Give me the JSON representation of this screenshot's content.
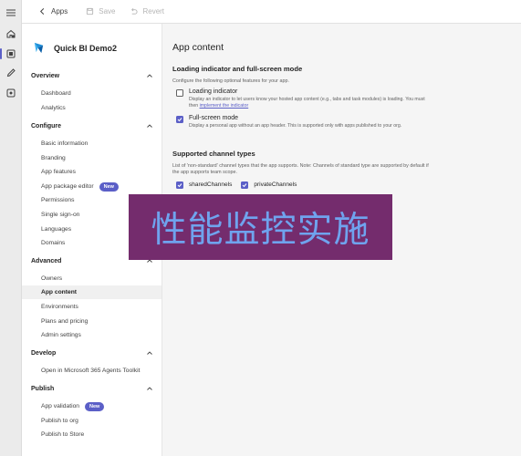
{
  "rail": {
    "icons": [
      "home-icon",
      "apps-icon",
      "edit-icon",
      "bot-icon"
    ]
  },
  "topbar": {
    "back_label": "Apps",
    "save_label": "Save",
    "revert_label": "Revert"
  },
  "sidebar": {
    "app_name": "Quick BI Demo2",
    "sections": [
      {
        "title": "Overview",
        "items": [
          "Dashboard",
          "Analytics"
        ]
      },
      {
        "title": "Configure",
        "items": [
          "Basic information",
          "Branding",
          "App features",
          "App package editor",
          "Permissions",
          "Single sign-on",
          "Languages",
          "Domains"
        ]
      },
      {
        "title": "Advanced",
        "items": [
          "Owners",
          "App content",
          "Environments",
          "Plans and pricing",
          "Admin settings"
        ]
      },
      {
        "title": "Develop",
        "items": [
          "Open in Microsoft 365 Agents Toolkit"
        ]
      },
      {
        "title": "Publish",
        "items": [
          "App validation",
          "Publish to org",
          "Publish to Store"
        ]
      }
    ],
    "badges": {
      "app_package_editor": "New",
      "app_validation": "New"
    },
    "selected_item": "App content"
  },
  "main": {
    "title": "App content",
    "loading_section": {
      "heading": "Loading indicator and full-screen mode",
      "description": "Configure the following optional features for your app.",
      "options": [
        {
          "label": "Loading indicator",
          "checked": false,
          "description": "Display an indicator to let users know your hosted app content (e.g., tabs and task modules) is loading. You must then",
          "link": "implement the indicator"
        },
        {
          "label": "Full-screen mode",
          "checked": true,
          "description": "Display a personal app without an app header. This is supported only with apps published to your org."
        }
      ]
    },
    "channel_section": {
      "heading": "Supported channel types",
      "description": "List of 'non-standard' channel types that the app supports. Note: Channels of standard type are supported by default if the app supports team scope.",
      "channels": [
        {
          "label": "sharedChannels",
          "checked": true
        },
        {
          "label": "privateChannels",
          "checked": true
        }
      ]
    }
  },
  "overlay": {
    "text": "性能监控实施"
  },
  "colors": {
    "accent": "#5b5fc7",
    "overlay_bg": "#742c6d",
    "overlay_text": "#6fa3ee"
  }
}
